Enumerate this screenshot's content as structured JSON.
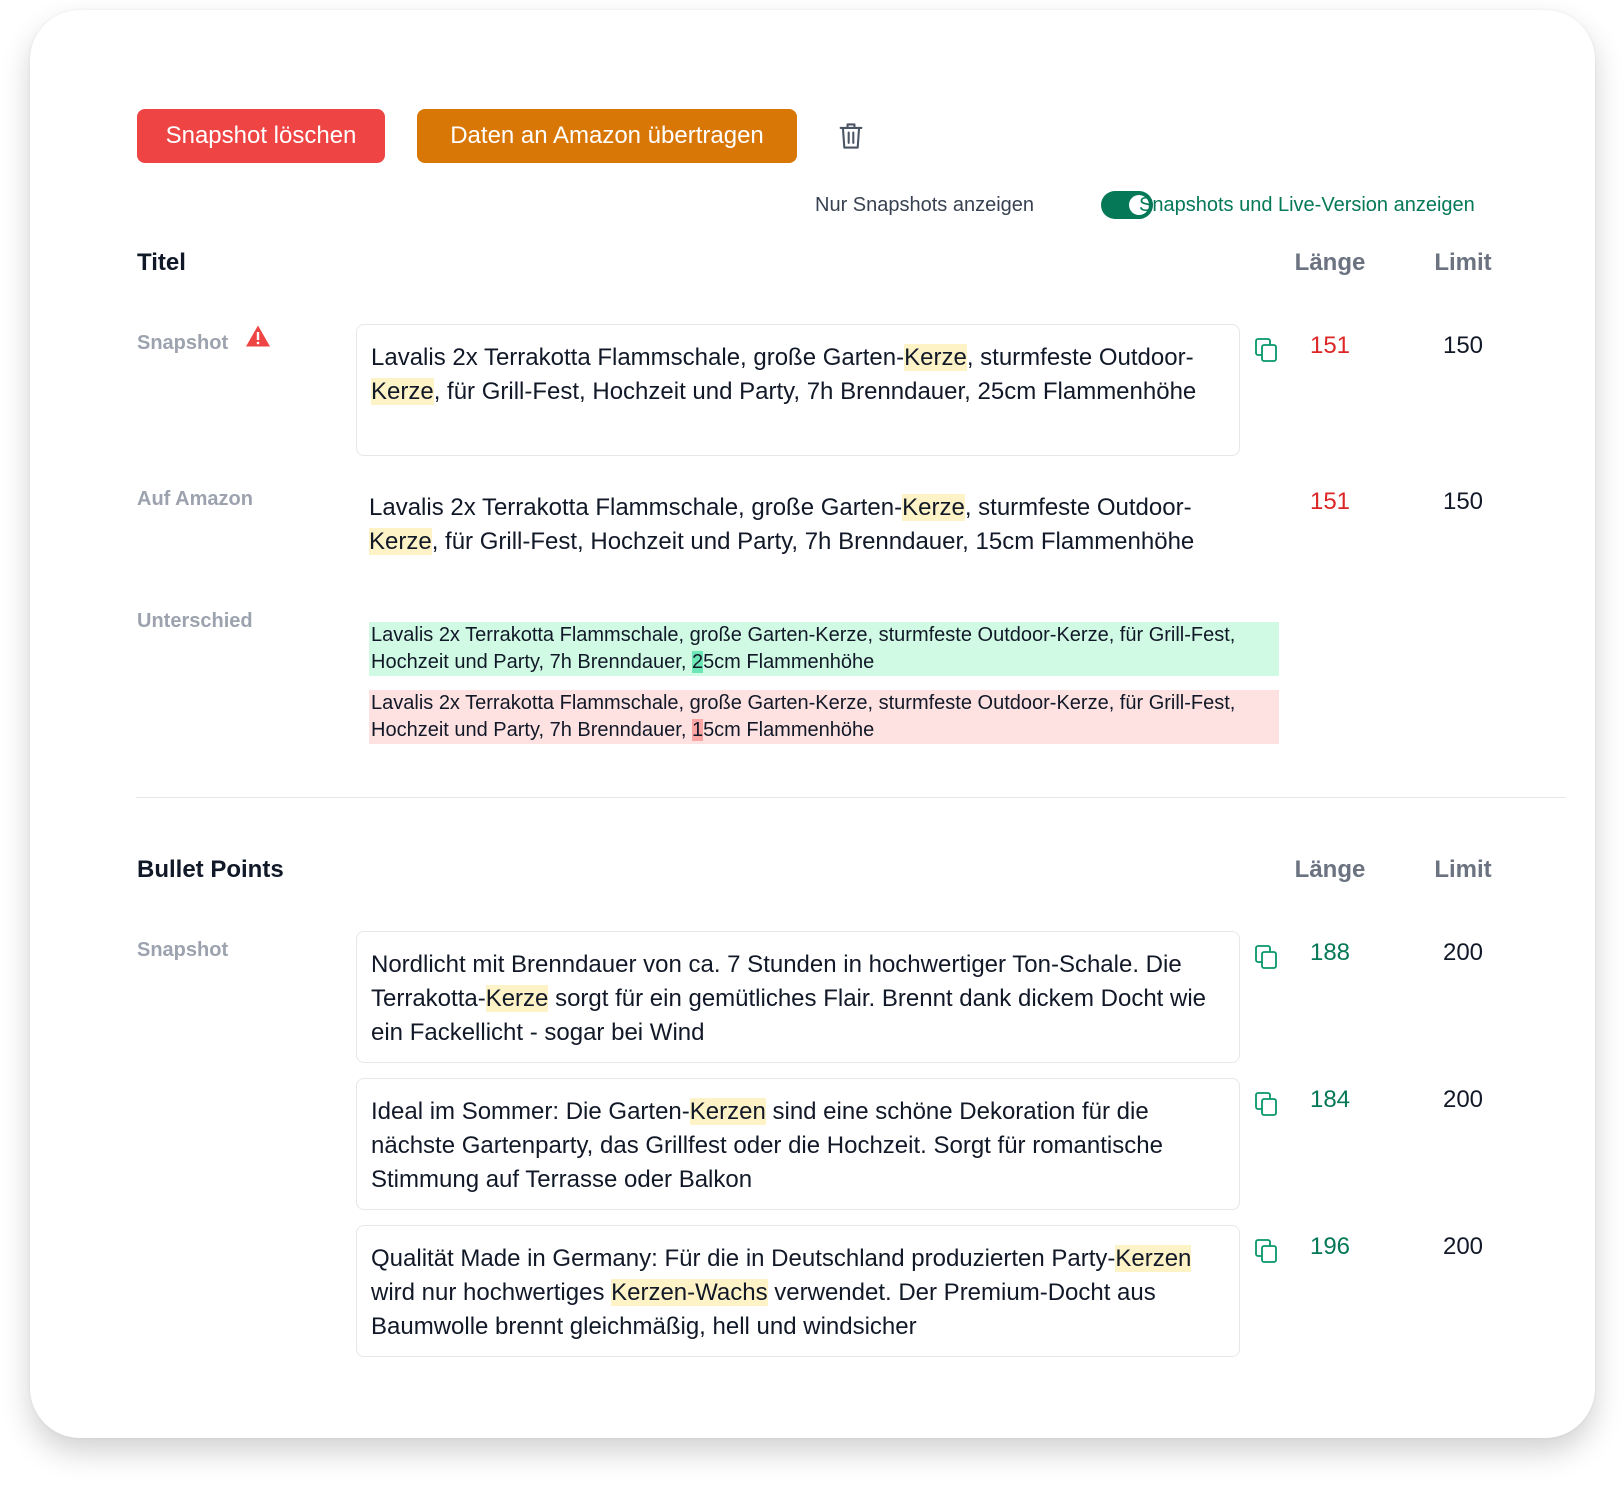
{
  "toolbar": {
    "delete_snapshot_label": "Snapshot löschen",
    "transfer_label": "Daten an Amazon übertragen"
  },
  "view_toggle": {
    "left_label": "Nur Snapshots anzeigen",
    "right_label": "Snapshots und Live-Version anzeigen",
    "state": "on"
  },
  "columns": {
    "length": "Länge",
    "limit": "Limit"
  },
  "title_section": {
    "heading": "Titel",
    "snapshot": {
      "label": "Snapshot",
      "text": "Lavalis 2x Terrakotta Flammschale, große Garten-Kerze, sturmfeste Outdoor-Kerze, für Grill-Fest, Hochzeit und Party, 7h Brenndauer, 25cm Flammenhöhe",
      "length": "151",
      "limit": "150"
    },
    "amazon": {
      "label": "Auf Amazon",
      "text": "Lavalis 2x Terrakotta Flammschale, große Garten-Kerze, sturmfeste Outdoor-Kerze, für Grill-Fest, Hochzeit und Party, 7h Brenndauer, 15cm Flammenhöhe",
      "length": "151",
      "limit": "150"
    },
    "diff": {
      "label": "Unterschied",
      "added_before": "Lavalis 2x Terrakotta Flammschale, große Garten-Kerze, sturmfeste Outdoor-Kerze, für Grill-Fest, Hochzeit und Party, 7h Brenndauer, ",
      "added_change": "2",
      "added_after": "5cm Flammenhöhe",
      "removed_before": "Lavalis 2x Terrakotta Flammschale, große Garten-Kerze, sturmfeste Outdoor-Kerze, für Grill-Fest, Hochzeit und Party, 7h Brenndauer, ",
      "removed_change": "1",
      "removed_after": "5cm Flammenhöhe"
    }
  },
  "bullets_section": {
    "heading": "Bullet Points",
    "snapshot_label": "Snapshot",
    "items": [
      {
        "text": "Nordlicht mit Brenndauer von ca. 7 Stunden in hochwertiger Ton-Schale. Die Terrakotta-Kerze sorgt für ein gemütliches Flair. Brennt dank dickem Docht wie ein Fackellicht - sogar bei Wind",
        "length": "188",
        "limit": "200"
      },
      {
        "text": "Ideal im Sommer: Die Garten-Kerzen sind eine schöne Dekoration für die nächste Gartenparty, das Grillfest oder die Hochzeit. Sorgt für romantische Stimmung auf Terrasse oder Balkon",
        "length": "184",
        "limit": "200"
      },
      {
        "text": "Qualität Made in Germany: Für die in Deutschland produzierten Party-Kerzen wird nur hochwertiges Kerzen-Wachs verwendet. Der Premium-Docht aus Baumwolle brennt gleichmäßig, hell und windsicher",
        "length": "196",
        "limit": "200"
      }
    ]
  },
  "keyword_highlight": [
    "Kerze",
    "Kerzen",
    "Kerzen-Wachs"
  ],
  "colors": {
    "danger": "#ef4444",
    "primary_orange": "#d97706",
    "success": "#047857",
    "over_limit": "#dc2626",
    "keyword_highlight": "#fef3c7",
    "diff_added": "#d1fae5",
    "diff_removed": "#fee2e2"
  },
  "icons": {
    "trash": "trash-icon",
    "warning": "warning-icon",
    "copy": "copy-icon"
  }
}
